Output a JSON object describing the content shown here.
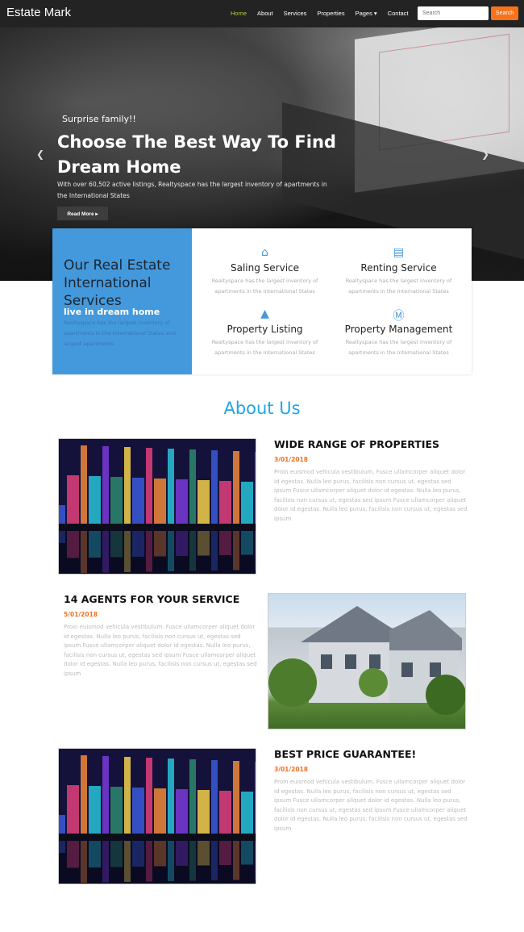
{
  "nav": {
    "brand": "Estate Mark",
    "items": [
      "Home",
      "About",
      "Services",
      "Properties",
      "Pages ▾",
      "Contact"
    ],
    "search_placeholder": "Search",
    "search_button": "Search"
  },
  "hero": {
    "subtitle": "Surprise family!!",
    "title": "Choose The Best Way To Find Dream Home",
    "description": "With over 60,502 active listings, Realtyspace has the largest inventory of apartments in the International States",
    "button": "Read More ▸"
  },
  "services": {
    "title": "Our Real Estate International Services",
    "subtitle": "live in dream home",
    "description": "Realtyspace has the largest inventory of apartments in the International States and largest apartments",
    "items": [
      {
        "icon": "home-icon",
        "title": "Saling Service",
        "text": "Realtyspace has the largest inventory of apartments in the International States"
      },
      {
        "icon": "garage-icon",
        "title": "Renting Service",
        "text": "Realtyspace has the largest inventory of apartments in the International States"
      },
      {
        "icon": "listing-icon",
        "title": "Property Listing",
        "text": "Realtyspace has the largest inventory of apartments in the International States"
      },
      {
        "icon": "management-icon",
        "title": "Property Management",
        "text": "Realtyspace has the largest inventory of apartments in the International States"
      }
    ]
  },
  "about": {
    "title": "About Us",
    "articles": [
      {
        "title": "WIDE RANGE OF PROPERTIES",
        "date": "3/01/2018",
        "text": "Proin euismod vehicula vestibulum. Fusce ullamcorper aliquet dolor id egestas. Nulla leo purus, facilisis non cursus ut, egestas sed ipsum Fusce ullamcorper aliquet dolor id egestas. Nulla leo purus, facilisis non cursus ut, egestas sed ipsum Fusce ullamcorper aliquet dolor id egestas. Nulla leo purus, facilisis non cursus ut, egestas sed ipsum"
      },
      {
        "title": "14 AGENTS FOR YOUR SERVICE",
        "date": "5/01/2018",
        "text": "Proin euismod vehicula vestibulum. Fusce ullamcorper aliquet dolor id egestas. Nulla leo purus, facilisis non cursus ut, egestas sed ipsum Fusce ullamcorper aliquet dolor id egestas. Nulla leo purus, facilisis non cursus ut, egestas sed ipsum Fusce ullamcorper aliquet dolor id egestas. Nulla leo purus, facilisis non cursus ut, egestas sed ipsum"
      },
      {
        "title": "BEST PRICE GUARANTEE!",
        "date": "3/01/2018",
        "text": "Proin euismod vehicula vestibulum. Fusce ullamcorper aliquet dolor id egestas. Nulla leo purus, facilisis non cursus ut, egestas sed ipsum Fusce ullamcorper aliquet dolor id egestas. Nulla leo purus, facilisis non cursus ut, egestas sed ipsum Fusce ullamcorper aliquet dolor id egestas. Nulla leo purus, facilisis non cursus ut, egestas sed ipsum"
      }
    ]
  },
  "colors": {
    "accent": "#f7721a",
    "blue": "#4499dd",
    "heading": "#1ea7e8"
  }
}
